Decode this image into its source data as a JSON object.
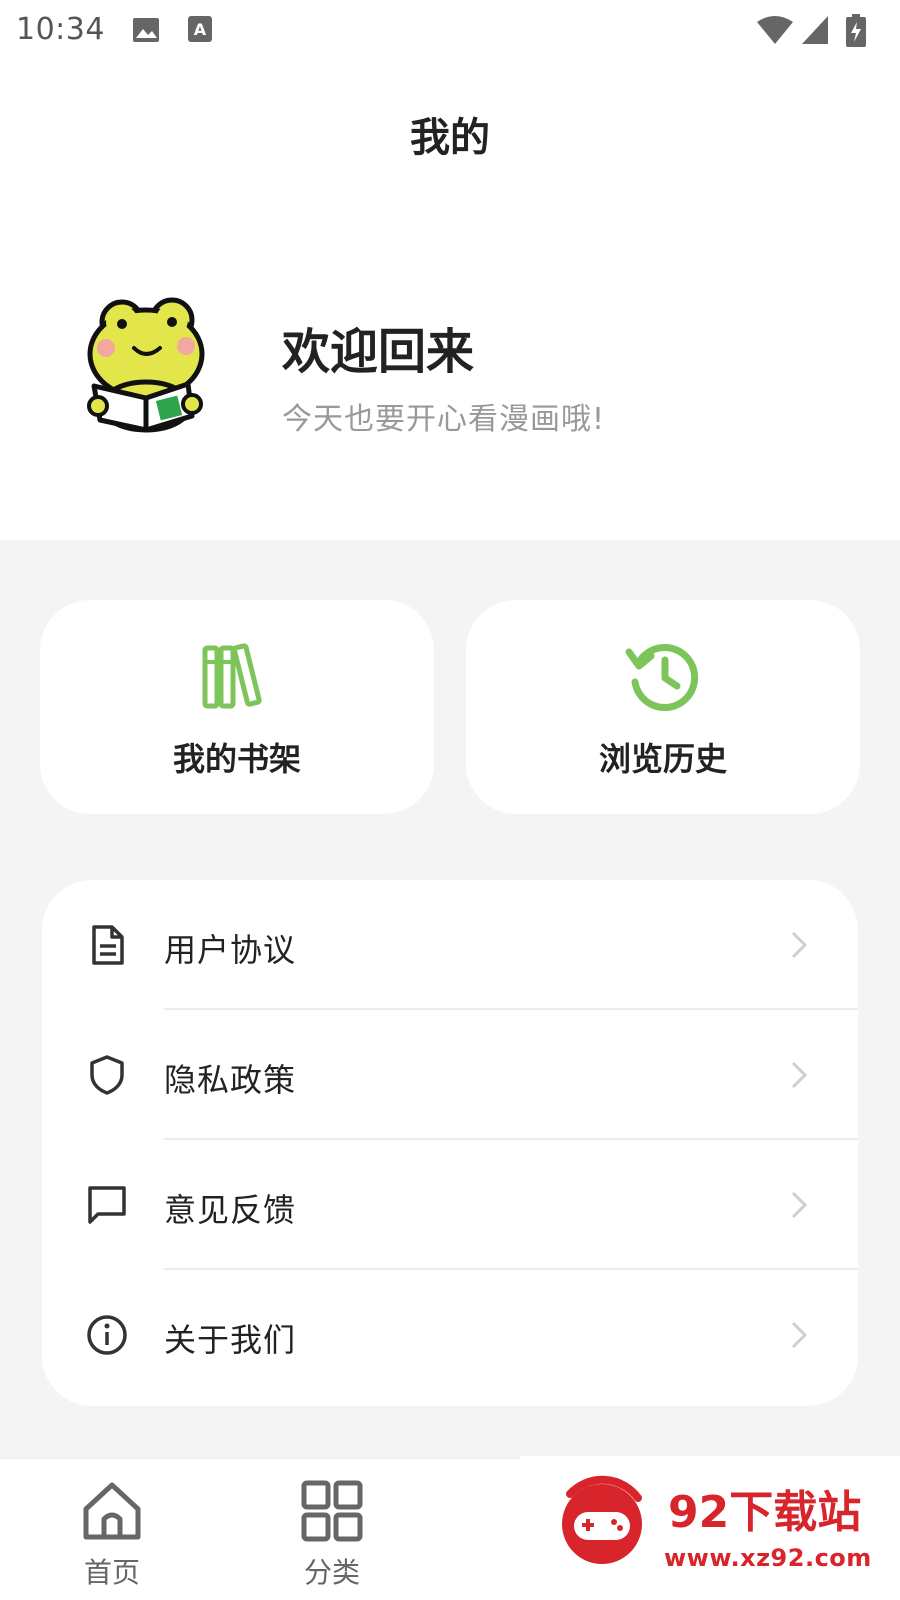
{
  "status_bar": {
    "time": "10:34",
    "icons": [
      "image-icon",
      "text-a-icon",
      "wifi-icon",
      "signal-icon",
      "battery-charging-icon"
    ]
  },
  "header": {
    "title": "我的"
  },
  "profile": {
    "avatar_icon": "frog-reading-avatar",
    "title": "欢迎回来",
    "subtitle": "今天也要开心看漫画哦!"
  },
  "quick_actions": [
    {
      "label": "我的书架",
      "icon": "bookshelf-icon"
    },
    {
      "label": "浏览历史",
      "icon": "history-icon"
    }
  ],
  "menu": [
    {
      "label": "用户协议",
      "icon": "document-icon"
    },
    {
      "label": "隐私政策",
      "icon": "shield-icon"
    },
    {
      "label": "意见反馈",
      "icon": "chat-bubble-icon"
    },
    {
      "label": "关于我们",
      "icon": "info-icon"
    }
  ],
  "bottom_nav": [
    {
      "label": "首页",
      "icon": "home-icon"
    },
    {
      "label": "分类",
      "icon": "category-grid-icon"
    }
  ],
  "watermark": {
    "title": "92下载站",
    "url": "www.xz92.com"
  },
  "colors": {
    "accent_green": "#7dc45a",
    "watermark_red": "#d8242b",
    "background_gray": "#f4f4f4"
  }
}
